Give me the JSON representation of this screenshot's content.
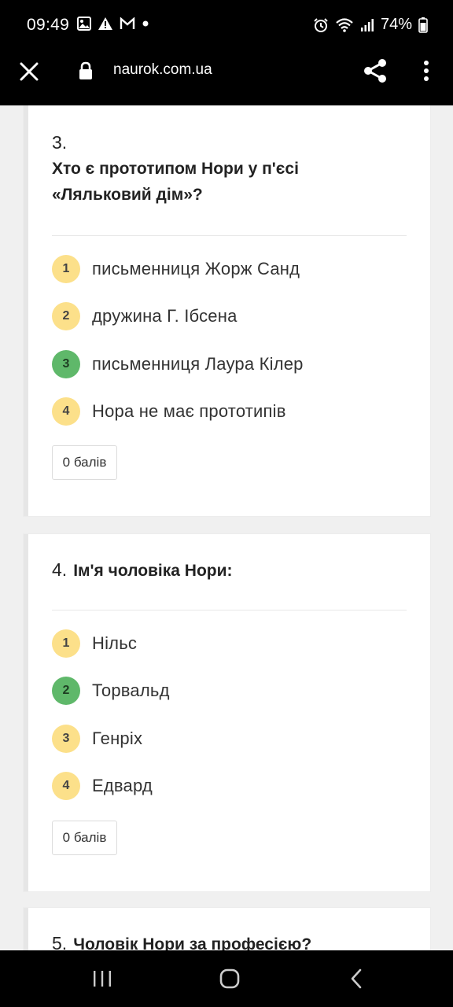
{
  "status_bar": {
    "time": "09:49",
    "battery": "74%",
    "left_icons": [
      "image-icon",
      "warning-icon",
      "gmail-icon",
      "dot-icon"
    ],
    "right_icons": [
      "alarm-icon",
      "wifi-icon",
      "signal-icon",
      "battery-icon"
    ]
  },
  "browser": {
    "url": "naurok.com.ua",
    "icons": [
      "close-icon",
      "lock-icon",
      "share-icon",
      "more-vertical-icon"
    ]
  },
  "questions": [
    {
      "number": "3.",
      "text": "Хто є прототипом Нори у п'єсі «Ляльковий дім»?",
      "answers": [
        {
          "index": "1",
          "text": "письменниця Жорж Санд",
          "state": "neutral"
        },
        {
          "index": "2",
          "text": "дружина Г. Ібсена",
          "state": "neutral"
        },
        {
          "index": "3",
          "text": "письменниця Лаура Кілер",
          "state": "correct"
        },
        {
          "index": "4",
          "text": "Нора не має прототипів",
          "state": "neutral"
        }
      ],
      "score": "0 балів"
    },
    {
      "number": "4.",
      "text": "Ім'я чоловіка Нори:",
      "answers": [
        {
          "index": "1",
          "text": "Нільс",
          "state": "neutral"
        },
        {
          "index": "2",
          "text": "Торвальд",
          "state": "correct"
        },
        {
          "index": "3",
          "text": "Генріх",
          "state": "neutral"
        },
        {
          "index": "4",
          "text": "Едвард",
          "state": "neutral"
        }
      ],
      "score": "0 балів"
    },
    {
      "number": "5.",
      "text": "Чоловік Нори за професією?"
    }
  ],
  "colors": {
    "correct": "#5fb86a",
    "neutral": "#fce08a",
    "bars": "#000000"
  }
}
